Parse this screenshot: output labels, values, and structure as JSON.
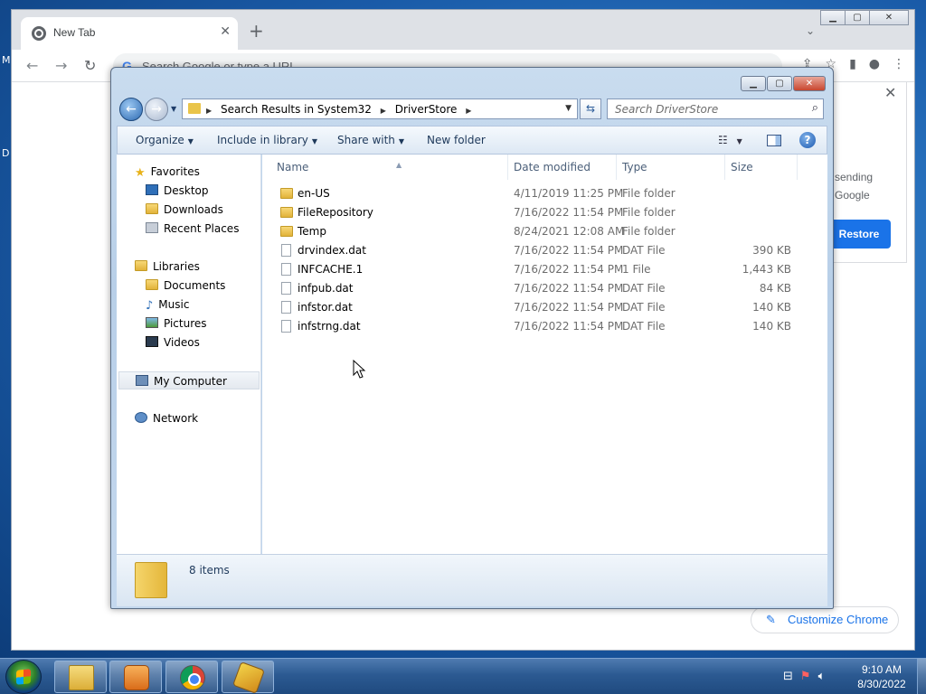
{
  "desktop": {
    "left_letters": [
      "M",
      "D"
    ]
  },
  "chrome": {
    "tab_title": "New Tab",
    "tab_close": "✕",
    "new_tab": "+",
    "omnibox_placeholder": "Search Google or type a URL",
    "restore_text_line1": "sending",
    "restore_text_line2": "Google",
    "restore_button": "Restore",
    "customize_button": "Customize Chrome"
  },
  "explorer": {
    "breadcrumb": [
      "Search Results in System32",
      "DriverStore"
    ],
    "search_placeholder": "Search DriverStore",
    "commands": {
      "organize": "Organize",
      "include_in_library": "Include in library",
      "share_with": "Share with",
      "new_folder": "New folder"
    },
    "nav": {
      "favorites": "Favorites",
      "desktop": "Desktop",
      "downloads": "Downloads",
      "recent_places": "Recent Places",
      "libraries": "Libraries",
      "documents": "Documents",
      "music": "Music",
      "pictures": "Pictures",
      "videos": "Videos",
      "my_computer": "My Computer",
      "network": "Network"
    },
    "columns": {
      "name": "Name",
      "date_modified": "Date modified",
      "type": "Type",
      "size": "Size"
    },
    "files": [
      {
        "name": "en-US",
        "date": "4/11/2019 11:25 PM",
        "type": "File folder",
        "size": "",
        "kind": "folder"
      },
      {
        "name": "FileRepository",
        "date": "7/16/2022 11:54 PM",
        "type": "File folder",
        "size": "",
        "kind": "folder"
      },
      {
        "name": "Temp",
        "date": "8/24/2021 12:08 AM",
        "type": "File folder",
        "size": "",
        "kind": "folder"
      },
      {
        "name": "drvindex.dat",
        "date": "7/16/2022 11:54 PM",
        "type": "DAT File",
        "size": "390 KB",
        "kind": "file"
      },
      {
        "name": "INFCACHE.1",
        "date": "7/16/2022 11:54 PM",
        "type": "1 File",
        "size": "1,443 KB",
        "kind": "file"
      },
      {
        "name": "infpub.dat",
        "date": "7/16/2022 11:54 PM",
        "type": "DAT File",
        "size": "84 KB",
        "kind": "file"
      },
      {
        "name": "infstor.dat",
        "date": "7/16/2022 11:54 PM",
        "type": "DAT File",
        "size": "140 KB",
        "kind": "file"
      },
      {
        "name": "infstrng.dat",
        "date": "7/16/2022 11:54 PM",
        "type": "DAT File",
        "size": "140 KB",
        "kind": "file"
      }
    ],
    "status_count": "8 items"
  },
  "taskbar": {
    "time": "9:10 AM",
    "date": "8/30/2022"
  }
}
